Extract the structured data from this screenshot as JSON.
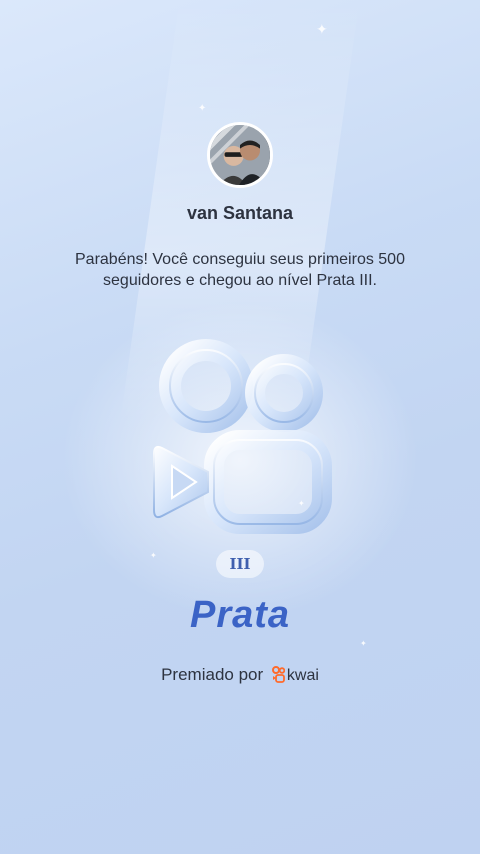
{
  "profile": {
    "username": "van Santana",
    "avatar_icon": "profile-photo"
  },
  "message": {
    "text": "Parabéns! Você conseguiu seus primeiros 500 seguidores e chegou ao nível Prata III."
  },
  "level": {
    "tier": "III",
    "name": "Prata",
    "badge_icon": "kwai-camera-badge-icon"
  },
  "footer": {
    "awarded_by": "Premiado por",
    "brand": "kwai",
    "brand_icon": "kwai-logo-icon",
    "brand_color": "#ff6a2b"
  },
  "colors": {
    "level_name": "#3b63c6",
    "background": "#c9dbf5"
  }
}
